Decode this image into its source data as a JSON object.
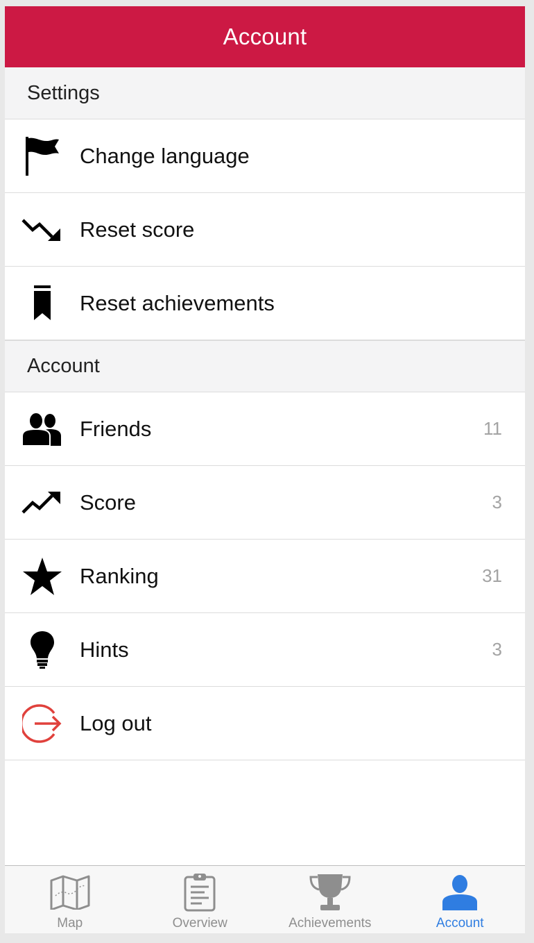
{
  "navbar": {
    "title": "Account"
  },
  "sections": [
    {
      "header": "Settings",
      "rows": [
        {
          "label": "Change language",
          "detail": "",
          "icon": "flag-icon"
        },
        {
          "label": "Reset score",
          "detail": "",
          "icon": "trend-down-icon"
        },
        {
          "label": "Reset achievements",
          "detail": "",
          "icon": "bookmark-icon"
        }
      ]
    },
    {
      "header": "Account",
      "rows": [
        {
          "label": "Friends",
          "detail": "11",
          "icon": "friends-icon"
        },
        {
          "label": "Score",
          "detail": "3",
          "icon": "trend-up-icon"
        },
        {
          "label": "Ranking",
          "detail": "31",
          "icon": "star-icon"
        },
        {
          "label": "Hints",
          "detail": "3",
          "icon": "lightbulb-icon"
        },
        {
          "label": "Log out",
          "detail": "",
          "icon": "logout-icon"
        }
      ]
    }
  ],
  "tabbar": {
    "tabs": [
      {
        "label": "Map",
        "icon": "map-icon",
        "active": false
      },
      {
        "label": "Overview",
        "icon": "clipboard-icon",
        "active": false
      },
      {
        "label": "Achievements",
        "icon": "trophy-icon",
        "active": false
      },
      {
        "label": "Account",
        "icon": "person-icon",
        "active": true
      }
    ]
  },
  "colors": {
    "brand": "#cc1944",
    "active_tab": "#2f7de1",
    "logout": "#e0413c",
    "detail_text": "#a3a3a3"
  }
}
